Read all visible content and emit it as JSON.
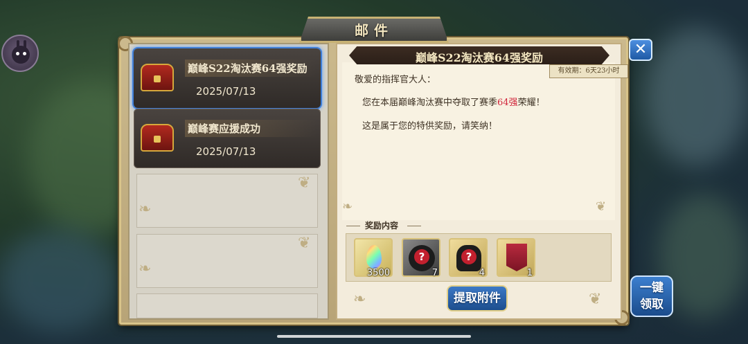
{
  "window": {
    "title": "邮件"
  },
  "mail_list": [
    {
      "title": "巅峰S22淘汰赛64强奖励",
      "date": "2025/07/13",
      "selected": true
    },
    {
      "title": "巅峰赛应援成功",
      "date": "2025/07/13",
      "selected": false
    }
  ],
  "detail": {
    "subject": "巅峰S22淘汰赛64强奖励",
    "expiry": "有效期：6天23小时",
    "greeting": "敬爱的指挥官大人：",
    "line1_prefix": "您在本届巅峰淘汰赛中夺取了赛季",
    "line1_highlight": "64强",
    "line1_suffix": "荣耀！",
    "line2": "这是属于您的特供奖励，请笑纳！",
    "rewards_label": "奖励内容",
    "rewards": [
      {
        "icon": "rainbow-crystal-icon",
        "count": "3500"
      },
      {
        "icon": "mystery-black-chest-icon",
        "count": "7"
      },
      {
        "icon": "mystery-black-bag-icon",
        "count": "4"
      },
      {
        "icon": "banner-emblem-icon",
        "count": "1"
      }
    ]
  },
  "buttons": {
    "claim": "提取附件",
    "claim_all": "一键领取",
    "close": "✕"
  },
  "colors": {
    "highlight": "#d0243a",
    "selected_outline": "#3f7fd9",
    "button_blue": "#1d4e8e"
  }
}
